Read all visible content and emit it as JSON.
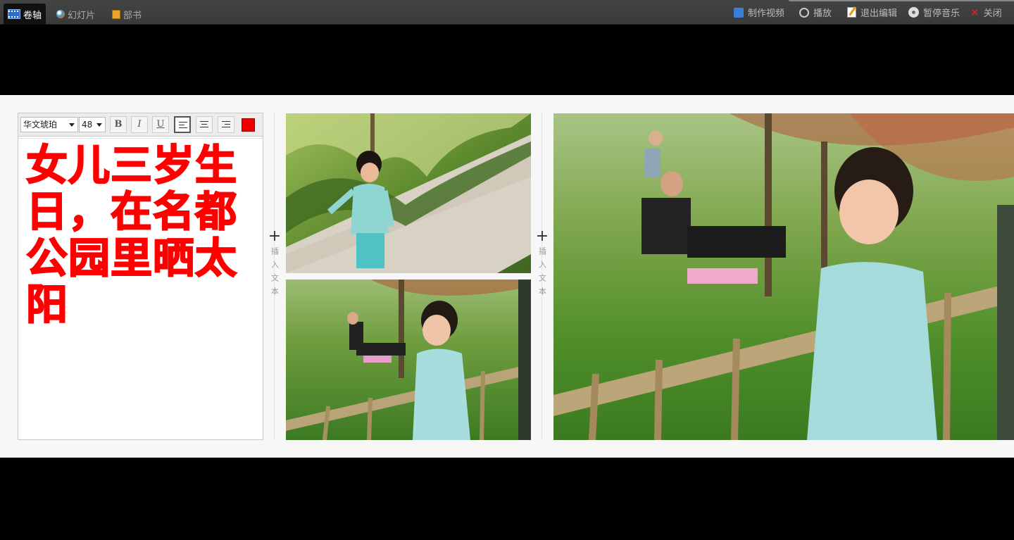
{
  "tabs": [
    {
      "label": "卷轴",
      "icon": "film-icon",
      "active": true
    },
    {
      "label": "幻灯片",
      "icon": "slideshow-icon",
      "active": false
    },
    {
      "label": "部书",
      "icon": "book-icon",
      "active": false
    }
  ],
  "actions": [
    {
      "label": "制作视频",
      "icon": "video-icon"
    },
    {
      "label": "播放",
      "icon": "play-icon"
    },
    {
      "label": "退出编辑",
      "icon": "edit-exit-icon"
    },
    {
      "label": "暂停音乐",
      "icon": "music-icon"
    },
    {
      "label": "关闭",
      "icon": "close-icon"
    }
  ],
  "text_toolbar": {
    "font": "华文琥珀",
    "size": "48",
    "bold": "B",
    "italic": "I",
    "underline": "U",
    "text_color": "#e00000"
  },
  "text_content": "女儿三岁生日，在名都公园里晒太阳",
  "insert_text_label": "插入文本",
  "colors": {
    "topbar": "#3f3f3f",
    "active_tab": "#111111",
    "strip_bg": "#f7f7f7",
    "text_red": "#ff0000"
  }
}
